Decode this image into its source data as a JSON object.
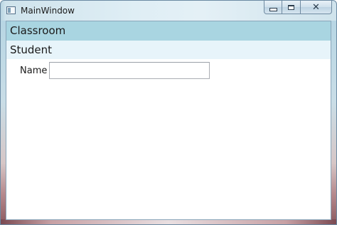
{
  "window": {
    "title": "MainWindow"
  },
  "classroom": {
    "header": "Classroom"
  },
  "student": {
    "header": "Student",
    "name_label": "Name",
    "name_value": ""
  },
  "colors": {
    "classroom_header_bg": "#a9d5e1",
    "student_header_bg": "#e7f4fa"
  },
  "icons": {
    "minimize": "minimize-icon",
    "maximize": "maximize-icon",
    "close": "close-icon",
    "app": "app-icon"
  }
}
